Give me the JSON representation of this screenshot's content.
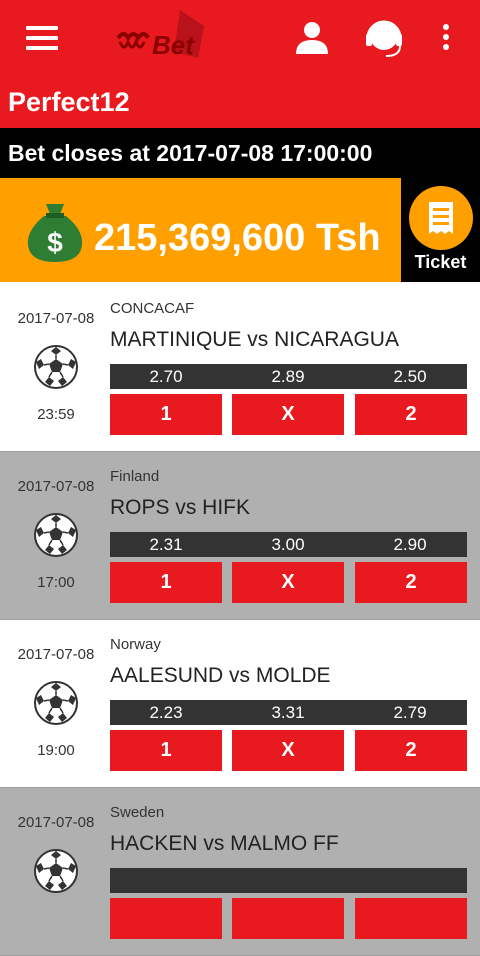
{
  "header": {
    "logo_text": "Bet",
    "title": "Perfect12",
    "bet_closes": "Bet closes at 2017-07-08 17:00:00",
    "jackpot": "215,369,600 Tsh",
    "ticket_label": "Ticket"
  },
  "colors": {
    "brand_red": "#e8191f",
    "accent_orange": "#ffa000",
    "odds_bar": "#333333",
    "row_grey": "#b0b0b0"
  },
  "icons": [
    "menu-icon",
    "user-icon",
    "support-headset-icon",
    "more-vert-icon",
    "money-bag-icon",
    "ticket-icon",
    "soccer-ball-icon"
  ],
  "matches": [
    {
      "date": "2017-07-08",
      "time": "23:59",
      "league": "CONCACAF",
      "teams": "MARTINIQUE vs NICARAGUA",
      "odds": [
        "2.70",
        "2.89",
        "2.50"
      ],
      "buttons": [
        "1",
        "X",
        "2"
      ]
    },
    {
      "date": "2017-07-08",
      "time": "17:00",
      "league": "Finland",
      "teams": "ROPS vs HIFK",
      "odds": [
        "2.31",
        "3.00",
        "2.90"
      ],
      "buttons": [
        "1",
        "X",
        "2"
      ]
    },
    {
      "date": "2017-07-08",
      "time": "19:00",
      "league": "Norway",
      "teams": "AALESUND vs MOLDE",
      "odds": [
        "2.23",
        "3.31",
        "2.79"
      ],
      "buttons": [
        "1",
        "X",
        "2"
      ]
    },
    {
      "date": "2017-07-08",
      "time": "",
      "league": "Sweden",
      "teams": "HACKEN vs MALMO FF",
      "odds": [
        "",
        "",
        ""
      ],
      "buttons": [
        "",
        "",
        ""
      ]
    }
  ]
}
